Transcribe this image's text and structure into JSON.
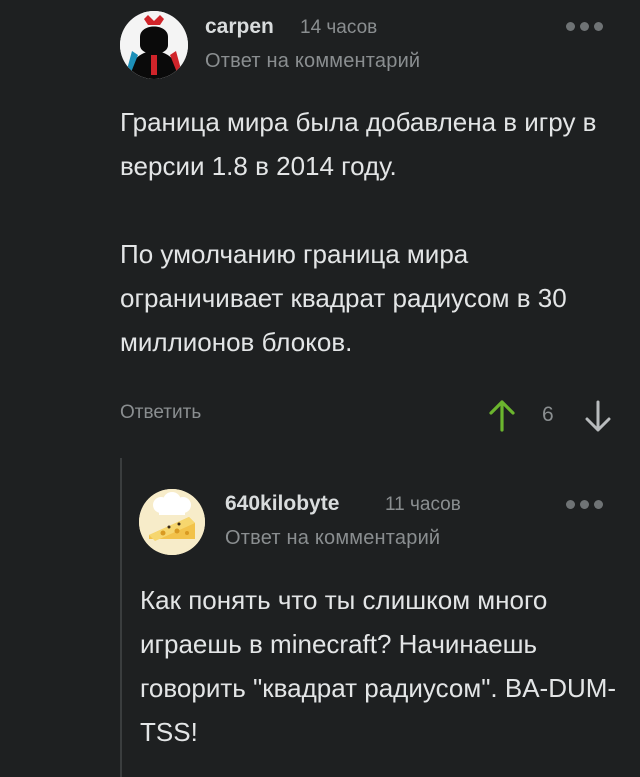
{
  "comments": [
    {
      "username": "carpen",
      "time": "14 часов",
      "reply_to": "Ответ на комментарий",
      "paragraphs": [
        "Граница мира была добавлена в игру в версии 1.8 в 2014 году.",
        "По умолчанию граница мира ограничивает квадрат радиусом в 30 миллионов блоков."
      ],
      "reply_label": "Ответить",
      "rating": "6",
      "upvote_color": "#6bb52e"
    },
    {
      "username": "640kilobyte",
      "time": "11 часов",
      "reply_to": "Ответ на комментарий",
      "paragraphs": [
        "Как понять что ты слишком много играешь в minecraft? Начинаешь говорить \"квадрат радиусом\". BA-DUM-TSS!"
      ]
    }
  ]
}
